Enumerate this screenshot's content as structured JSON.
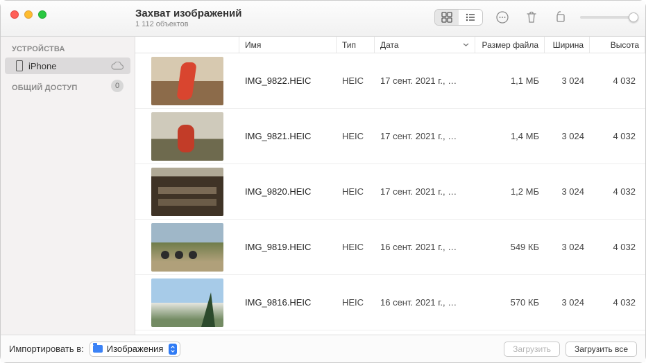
{
  "window": {
    "title": "Захват изображений",
    "subtitle": "1 112 объектов"
  },
  "sidebar": {
    "devices_header": "УСТРОЙСТВА",
    "shared_header": "ОБЩИЙ ДОСТУП",
    "device_name": "iPhone",
    "shared_count": "0"
  },
  "columns": {
    "name": "Имя",
    "type": "Тип",
    "date": "Дата",
    "size": "Размер файла",
    "width": "Ширина",
    "height": "Высота"
  },
  "rows": [
    {
      "name": "IMG_9822.HEIC",
      "type": "HEIC",
      "date": "17 сент. 2021 г., …",
      "size": "1,1 МБ",
      "w": "3 024",
      "h": "4 032"
    },
    {
      "name": "IMG_9821.HEIC",
      "type": "HEIC",
      "date": "17 сент. 2021 г., …",
      "size": "1,4 МБ",
      "w": "3 024",
      "h": "4 032"
    },
    {
      "name": "IMG_9820.HEIC",
      "type": "HEIC",
      "date": "17 сент. 2021 г., …",
      "size": "1,2 МБ",
      "w": "3 024",
      "h": "4 032"
    },
    {
      "name": "IMG_9819.HEIC",
      "type": "HEIC",
      "date": "16 сент. 2021 г., …",
      "size": "549 КБ",
      "w": "3 024",
      "h": "4 032"
    },
    {
      "name": "IMG_9816.HEIC",
      "type": "HEIC",
      "date": "16 сент. 2021 г., …",
      "size": "570 КБ",
      "w": "3 024",
      "h": "4 032"
    }
  ],
  "footer": {
    "import_to": "Импортировать в:",
    "destination": "Изображения",
    "download": "Загрузить",
    "download_all": "Загрузить все"
  }
}
